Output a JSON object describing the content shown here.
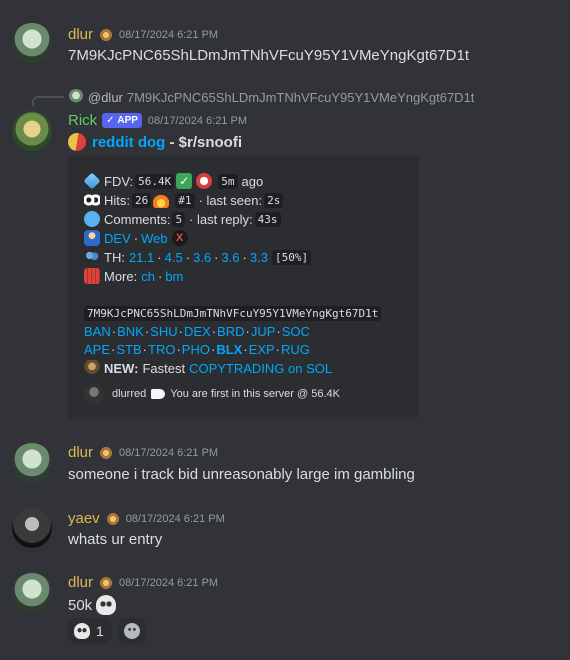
{
  "colors": {
    "background": "#313338",
    "embed_bg": "#2b2d31",
    "dlur_name": "#e0b754",
    "rick_name": "#5ecf68",
    "yaev_name": "#e0b754",
    "link": "#00a8fc",
    "timestamp": "#949ba4",
    "app_badge": "#5865f2"
  },
  "messages": [
    {
      "author": "dlur",
      "timestamp": "08/17/2024 6:21 PM",
      "content": "7M9KJcPNC65ShLDmJmTNhVFcuY95Y1VMeYngKgt67D1t",
      "badge_icon": "server-tag-icon"
    },
    {
      "reply_to": {
        "author": "@dlur",
        "content": "7M9KJcPNC65ShLDmJmTNhVFcuY95Y1VMeYngKgt67D1t"
      },
      "author": "Rick",
      "app_badge": "APP",
      "timestamp": "08/17/2024 6:21 PM",
      "title": {
        "icon": "pill-icon",
        "name": "reddit dog",
        "separator": " - ",
        "ticker": "$r/snoofi"
      },
      "embed": {
        "fdv_label": "FDV:",
        "fdv_value": "56.4K",
        "fdv_age": "5m",
        "fdv_age_suffix": "ago",
        "hits_label": "Hits:",
        "hits_value": "26",
        "hits_rank": "#1",
        "last_seen_label": "· last seen:",
        "last_seen_value": "2s",
        "comments_label": "Comments:",
        "comments_value": "5",
        "last_reply_label": "· last reply:",
        "last_reply_value": "43s",
        "dev_label": "DEV",
        "web_label": "Web",
        "th_label": "TH:",
        "th_values": [
          "21.1",
          "4.5",
          "3.6",
          "3.6",
          "3.3"
        ],
        "th_total": "[50%]",
        "more_label": "More:",
        "more_links": [
          "ch",
          "bm"
        ],
        "contract": "7M9KJcPNC65ShLDmJmTNhVFcuY95Y1VMeYngKgt67D1t",
        "trade_links_row1": [
          "BAN",
          "BNK",
          "SHU",
          "DEX",
          "BRD",
          "JUP",
          "SOC"
        ],
        "trade_links_row2": [
          "APE",
          "STB",
          "TRO",
          "PHO",
          "BLX",
          "EXP",
          "RUG"
        ],
        "new_label": "NEW:",
        "new_text": "Fastest",
        "new_link": "COPYTRADING on SOL",
        "footer_user": "dlurred",
        "footer_text": "You are first in this server @ 56.4K"
      }
    },
    {
      "author": "dlur",
      "timestamp": "08/17/2024 6:21 PM",
      "content": "someone i track bid unreasonably large im gambling"
    },
    {
      "author": "yaev",
      "timestamp": "08/17/2024 6:21 PM",
      "content": "whats ur entry"
    },
    {
      "author": "dlur",
      "timestamp": "08/17/2024 6:21 PM",
      "content": "50k",
      "reactions": [
        {
          "icon": "skull-icon",
          "count": "1"
        }
      ]
    }
  ]
}
